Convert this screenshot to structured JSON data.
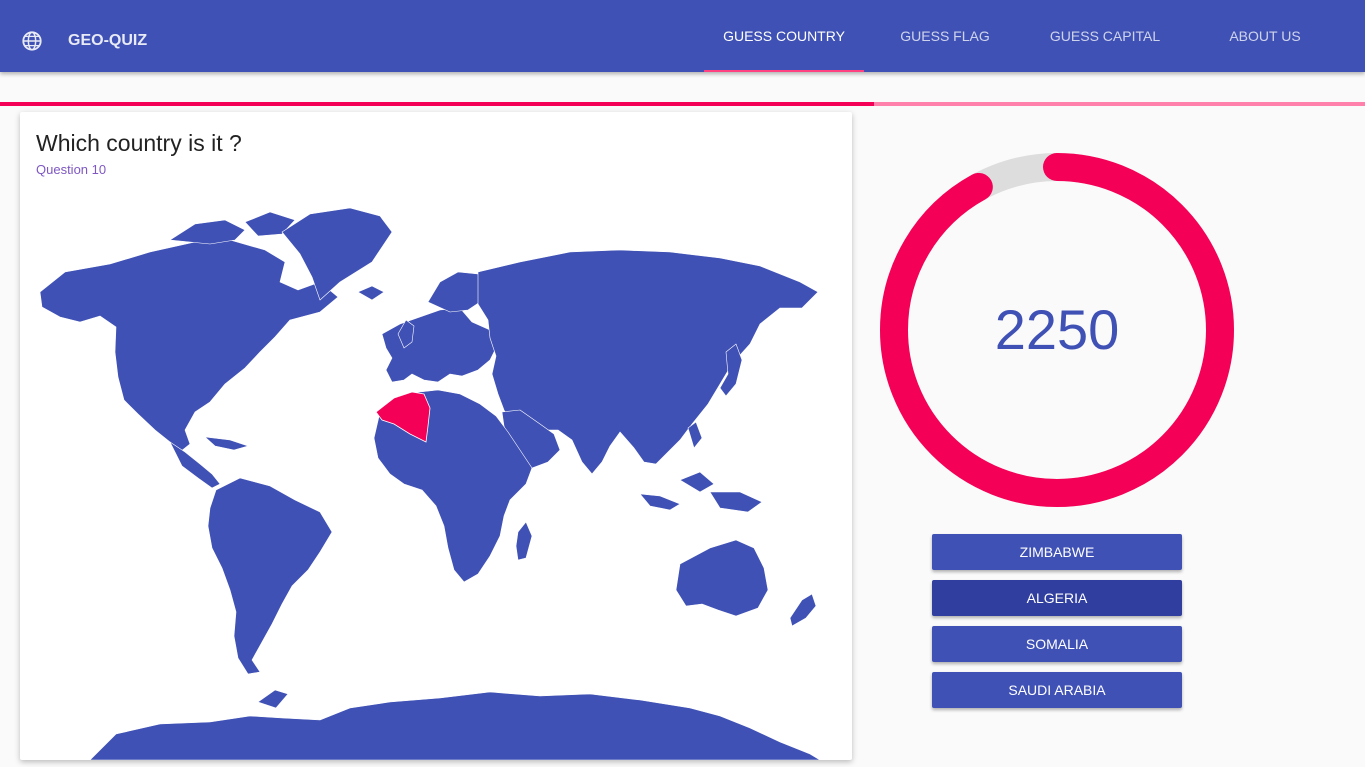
{
  "app": {
    "title": "GEO-QUIZ",
    "logo_icon": "globe-icon"
  },
  "nav": {
    "tabs": [
      {
        "label": "GUESS COUNTRY",
        "active": true
      },
      {
        "label": "GUESS FLAG",
        "active": false
      },
      {
        "label": "GUESS CAPITAL",
        "active": false
      },
      {
        "label": "ABOUT US",
        "active": false
      }
    ]
  },
  "quiz_progress": {
    "fraction": 0.64
  },
  "question": {
    "title": "Which country is it ?",
    "subtitle": "Question 10",
    "highlighted_country": "Algeria"
  },
  "score": {
    "value": "2250",
    "ring_fraction": 0.92
  },
  "answers": [
    {
      "label": "ZIMBABWE",
      "selected": false
    },
    {
      "label": "ALGERIA",
      "selected": true
    },
    {
      "label": "SOMALIA",
      "selected": false
    },
    {
      "label": "SAUDI ARABIA",
      "selected": false
    }
  ],
  "colors": {
    "primary": "#3f51b5",
    "primary_dark": "#303f9f",
    "accent": "#f50057",
    "accent_light": "#ff80ab",
    "ring_track": "#dddddd"
  }
}
